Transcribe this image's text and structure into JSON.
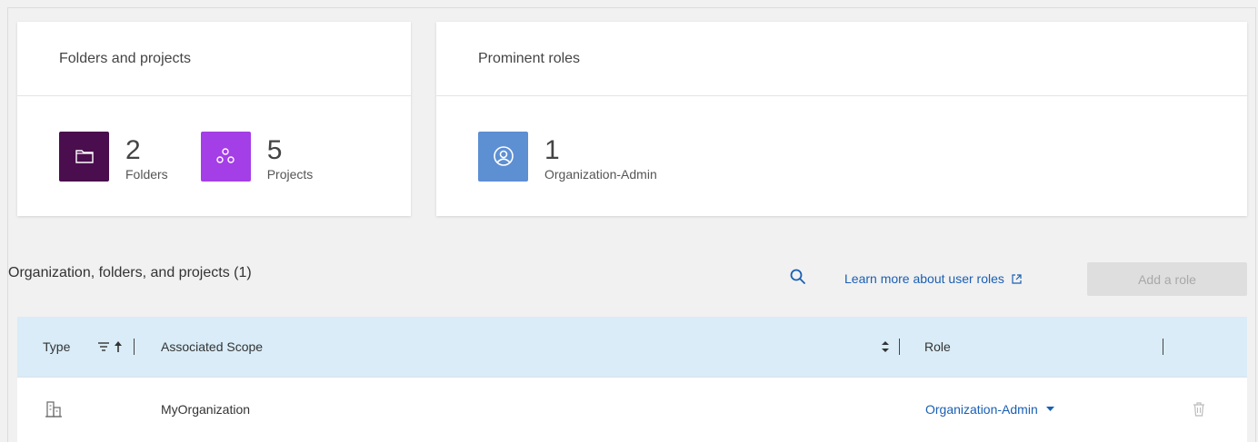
{
  "cards": {
    "folders_projects": {
      "title": "Folders and projects",
      "folders": {
        "count": "2",
        "label": "Folders",
        "color": "#4a0e4e"
      },
      "projects": {
        "count": "5",
        "label": "Projects",
        "color": "#a43ee6"
      }
    },
    "roles": {
      "title": "Prominent roles",
      "org_admin": {
        "count": "1",
        "label": "Organization-Admin",
        "color": "#5d8fd3"
      }
    }
  },
  "section": {
    "title": "Organization, folders, and projects (1)",
    "learn_more": "Learn more about user roles",
    "add_role": "Add a role"
  },
  "table": {
    "headers": {
      "type": "Type",
      "scope": "Associated Scope",
      "role": "Role"
    },
    "rows": [
      {
        "type_icon": "organization-icon",
        "scope": "MyOrganization",
        "role": "Organization-Admin"
      }
    ]
  },
  "colors": {
    "link": "#1a5fb4",
    "table_header": "#d9ecf8"
  }
}
